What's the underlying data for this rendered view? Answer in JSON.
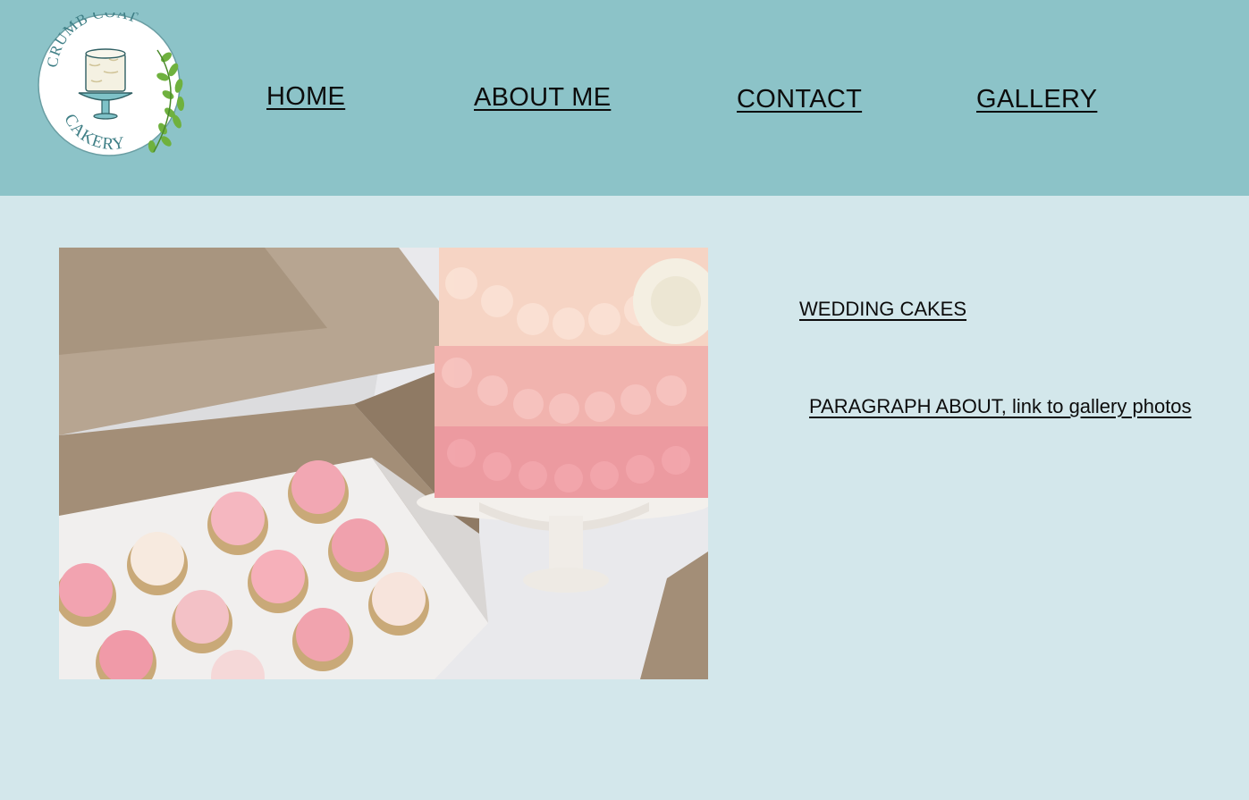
{
  "logo": {
    "line1": "CRUMB COAT",
    "line2": "CAKERY"
  },
  "nav": {
    "home": "HOME",
    "about": "ABOUT ME",
    "contact": "CONTACT",
    "gallery": "GALLERY"
  },
  "content": {
    "section_title": "WEDDING CAKES",
    "paragraph_link": "PARAGRAPH ABOUT, link to gallery photos"
  },
  "colors": {
    "header_bg": "#8cc3c8",
    "page_bg": "#d3e7eb",
    "text": "#0c0c0c"
  }
}
